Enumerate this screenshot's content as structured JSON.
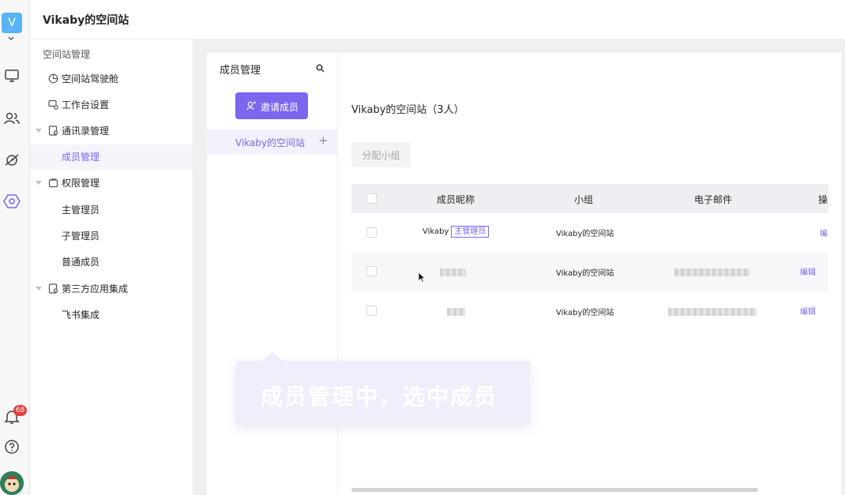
{
  "space": {
    "avatar_letter": "V",
    "name": "Vikaby的空间站",
    "notification_count": "68"
  },
  "sidebar": {
    "section_title": "空间站管理",
    "items": [
      {
        "label": "空间站驾驶舱",
        "icon": "dashboard-icon"
      },
      {
        "label": "工作台设置",
        "icon": "workbench-icon"
      },
      {
        "label": "通讯录管理",
        "icon": "contacts-icon",
        "expandable": true
      },
      {
        "label": "成员管理",
        "active": true
      },
      {
        "label": "权限管理",
        "icon": "permission-icon",
        "expandable": true
      },
      {
        "label": "主管理员"
      },
      {
        "label": "子管理员"
      },
      {
        "label": "普通成员"
      },
      {
        "label": "第三方应用集成",
        "icon": "integration-icon",
        "expandable": true
      },
      {
        "label": "飞书集成"
      }
    ]
  },
  "member_panel": {
    "title": "成员管理",
    "invite_button": "邀请成员",
    "team_name": "Vikaby的空间站",
    "content_title": "Vikaby的空间站（3人）",
    "assign_button": "分配小组",
    "columns": [
      "成员昵称",
      "小组",
      "电子邮件",
      "操"
    ],
    "rows": [
      {
        "nickname": "Vikaby",
        "tag": "主管理员",
        "group": "Vikaby的空间站",
        "email": "",
        "action": "编"
      },
      {
        "nickname": "",
        "group": "Vikaby的空间站",
        "email": "",
        "action": "编辑"
      },
      {
        "nickname": "",
        "group": "Vikaby的空间站",
        "email": "",
        "action": "编辑"
      }
    ]
  },
  "tooltip": {
    "text": "成员管理中，选中成员"
  },
  "colors": {
    "accent": "#7b67ee",
    "avatar": "#58b4f6",
    "badge": "#e04040"
  }
}
